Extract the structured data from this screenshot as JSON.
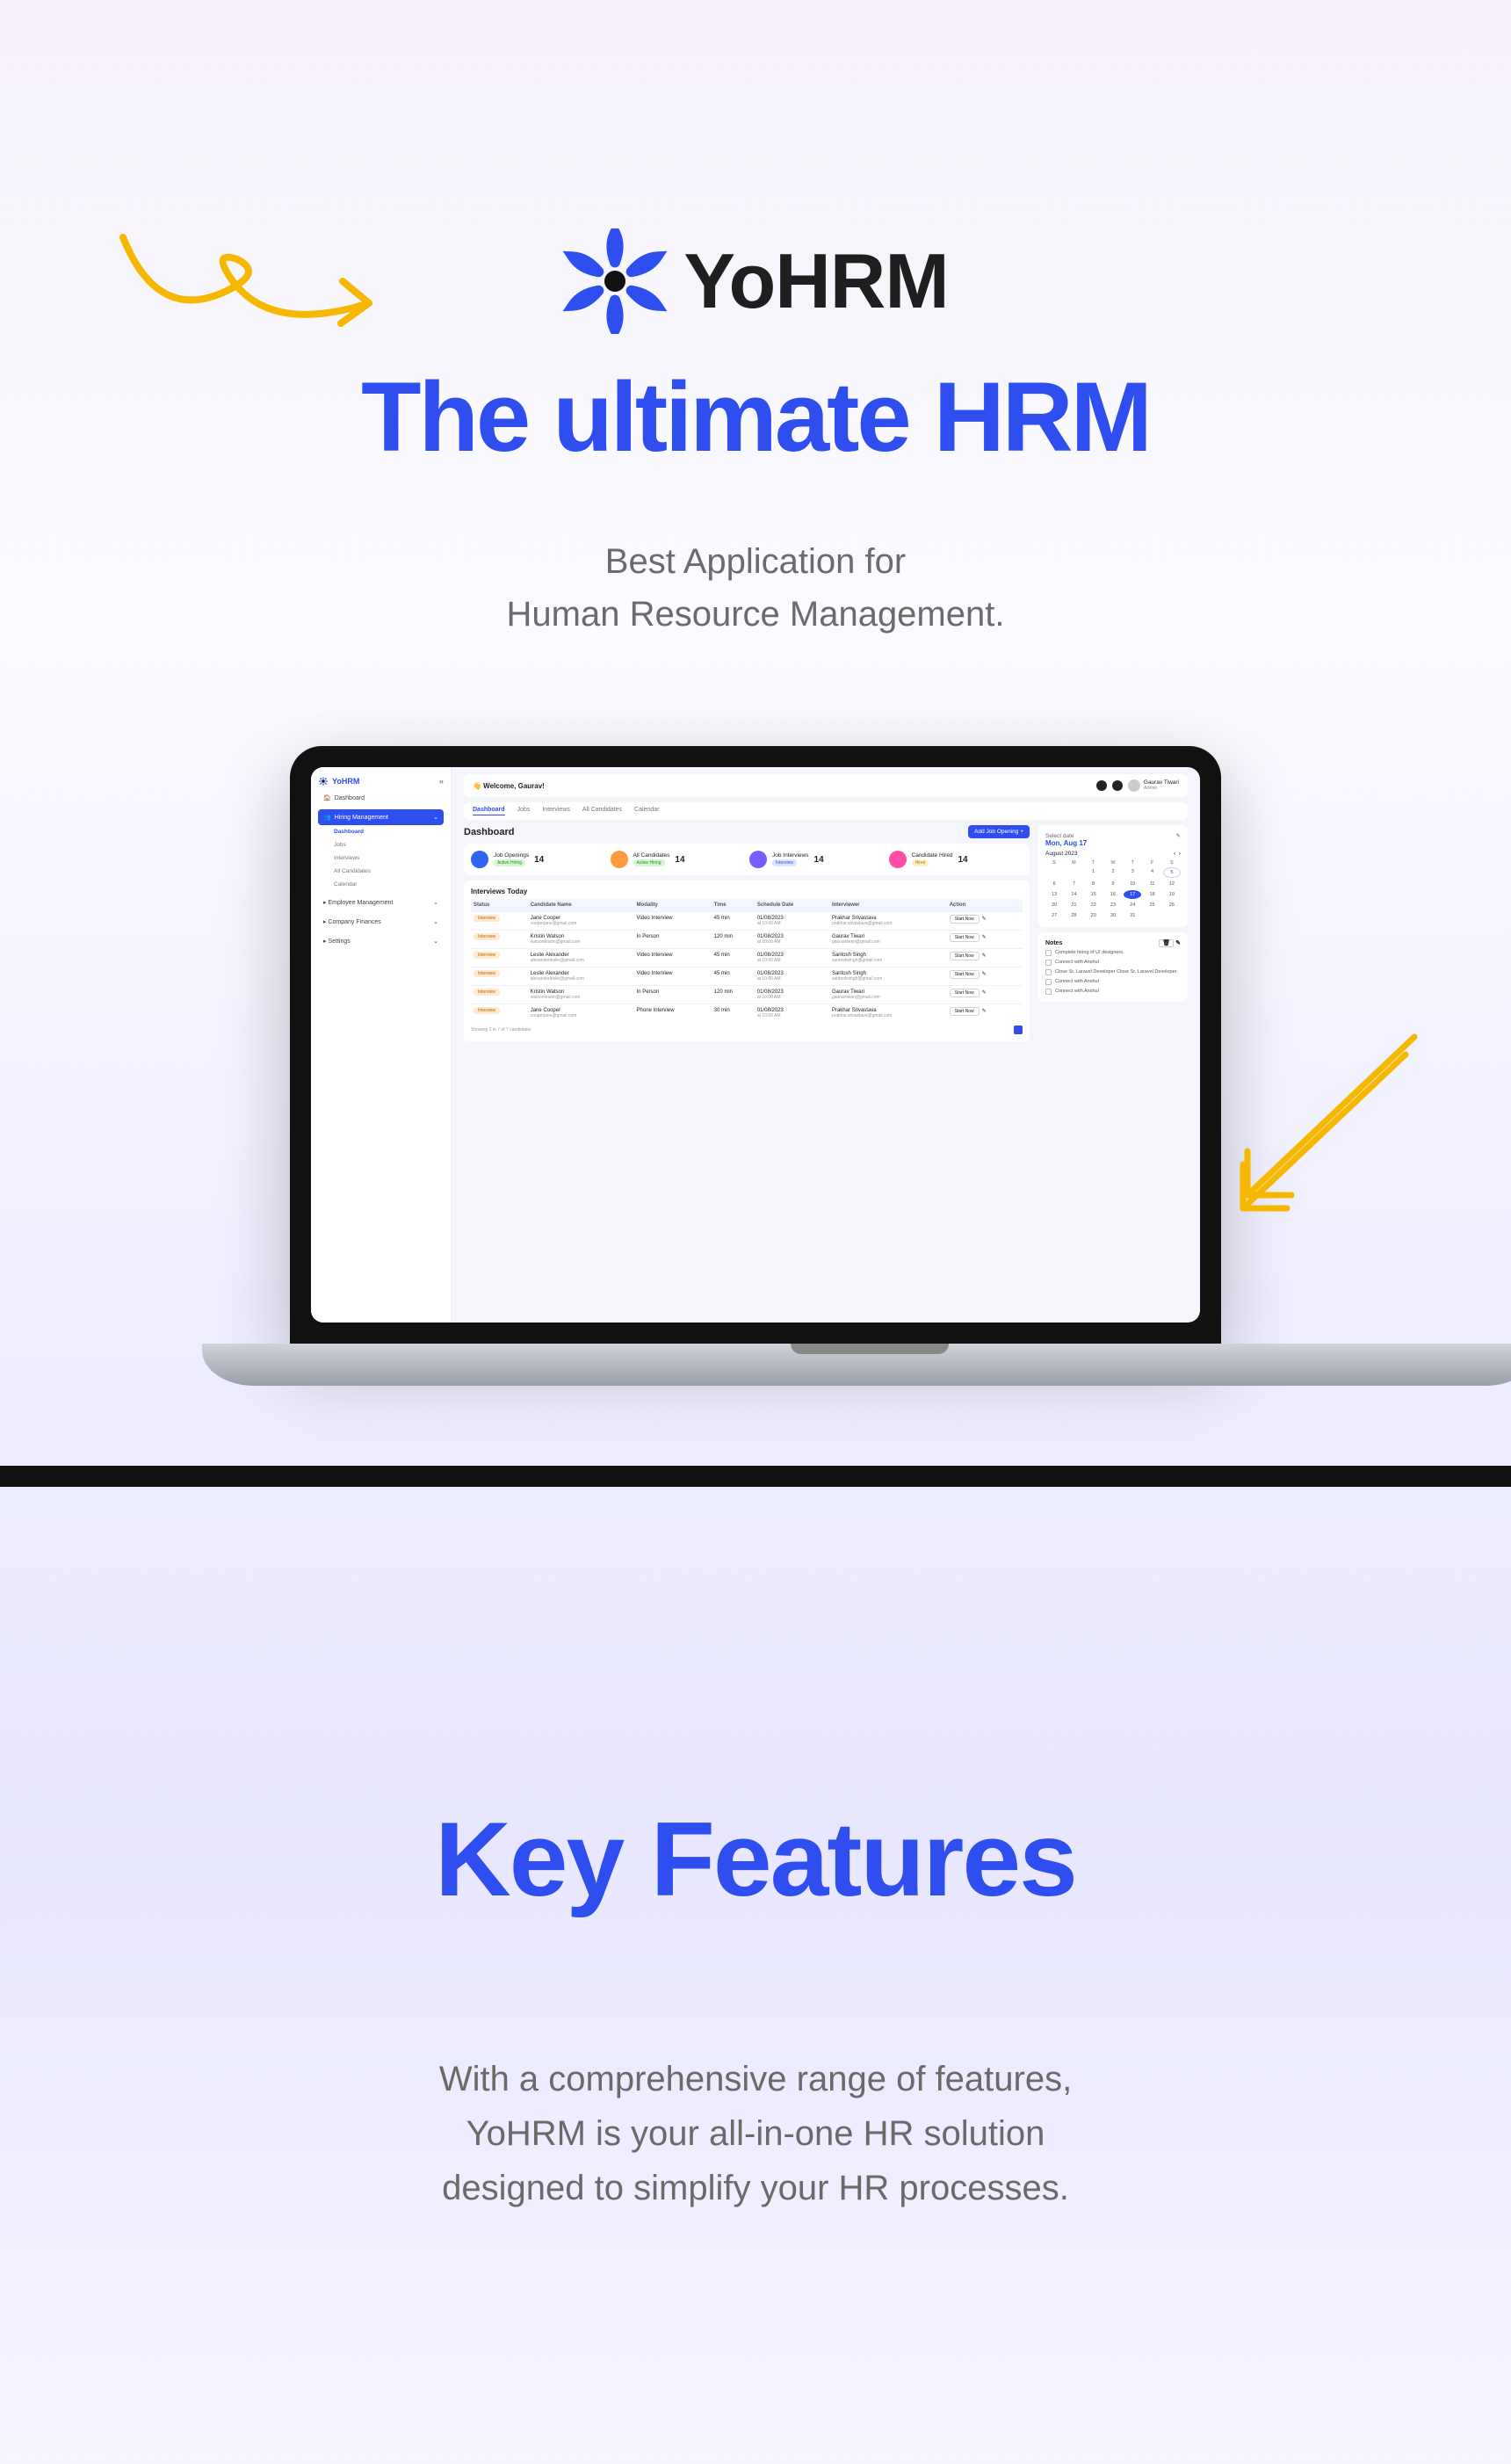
{
  "brand": {
    "name": "YoHRM"
  },
  "hero": {
    "headline": "The ultimate HRM",
    "sub1": "Best Application for",
    "sub2": "Human Resource Management."
  },
  "dashboard": {
    "sidebar_logo": "YoHRM",
    "sidebar": {
      "items": [
        {
          "icon": "home",
          "label": "Dashboard"
        },
        {
          "icon": "hiring",
          "label": "Hiring Management"
        }
      ],
      "subitems": [
        "Dashboard",
        "Jobs",
        "Interviews",
        "All Candidates",
        "Calendar"
      ],
      "items2": [
        {
          "icon": "emp",
          "label": "Employee Management"
        },
        {
          "icon": "fin",
          "label": "Company Finances"
        },
        {
          "icon": "set",
          "label": "Settings"
        }
      ]
    },
    "topbar": {
      "welcome_prefix": "👋 Welcome, ",
      "welcome_name": "Gaurav!",
      "user_name": "Gaurav Tiwari",
      "user_role": "Admin"
    },
    "tabs": [
      "Dashboard",
      "Jobs",
      "Interviews",
      "All Candidates",
      "Calendar"
    ],
    "title": "Dashboard",
    "add_button": "Add Job Opening  +",
    "stats": [
      {
        "label": "Job Openings",
        "value": "14",
        "pill": "Active Hiring",
        "pill_cls": "p-green",
        "color": "c-blue"
      },
      {
        "label": "All Candidates",
        "value": "14",
        "pill": "Active Hiring",
        "pill_cls": "p-green",
        "color": "c-orange"
      },
      {
        "label": "Job Interviews",
        "value": "14",
        "pill": "Interview",
        "pill_cls": "p-blue",
        "color": "c-purple"
      },
      {
        "label": "Candidate Hired",
        "value": "14",
        "pill": "Hired",
        "pill_cls": "p-yellow",
        "color": "c-pink"
      }
    ],
    "table_title": "Interviews Today",
    "columns": [
      "Status",
      "Candidate Name",
      "Modality",
      "Time",
      "Schedule Date",
      "Interviewer",
      "Action"
    ],
    "status_label": "Interview",
    "action_start": "Start Now",
    "rows": [
      {
        "name": "Jane Cooper",
        "email": "cooperjane@gmail.com",
        "modality": "Video Interview",
        "time": "45 min",
        "date": "01/08/2023",
        "date2": "at 10:00 AM",
        "interviewer": "Prakhar Srivastava",
        "interviewer_email": "prakhar.srivastava@gmail.com"
      },
      {
        "name": "Kristin Watson",
        "email": "watsonkristin@gmail.com",
        "modality": "In Person",
        "time": "120 min",
        "date": "01/08/2023",
        "date2": "at 10:00 AM",
        "interviewer": "Gaurav Tiwari",
        "interviewer_email": "gauravtiwari@gmail.com"
      },
      {
        "name": "Leslie Alexander",
        "email": "alexanderleslie@gmail.com",
        "modality": "Video Interview",
        "time": "45 min",
        "date": "01/08/2023",
        "date2": "at 10:00 AM",
        "interviewer": "Santosh Singh",
        "interviewer_email": "santoshsingh@gmail.com"
      },
      {
        "name": "Leslie Alexander",
        "email": "alexanderleslie@gmail.com",
        "modality": "Video Interview",
        "time": "45 min",
        "date": "01/08/2023",
        "date2": "at 10:00 AM",
        "interviewer": "Santosh Singh",
        "interviewer_email": "santoshsingh@gmail.com"
      },
      {
        "name": "Kristin Watson",
        "email": "watsonkristin@gmail.com",
        "modality": "In Person",
        "time": "120 min",
        "date": "01/08/2023",
        "date2": "at 10:00 AM",
        "interviewer": "Gaurav Tiwari",
        "interviewer_email": "gauravtiwari@gmail.com"
      },
      {
        "name": "Jane Cooper",
        "email": "cooperjane@gmail.com",
        "modality": "Phone Interview",
        "time": "30 min",
        "date": "01/08/2023",
        "date2": "at 10:00 AM",
        "interviewer": "Prakhar Srivastava",
        "interviewer_email": "prakhar.srivastava@gmail.com"
      }
    ],
    "paging_text": "Showing 1 to 7 of 7 candidates",
    "calendar": {
      "select_label": "Select date",
      "selected": "Mon, Aug 17",
      "month": "August 2023",
      "dow": [
        "S",
        "M",
        "T",
        "W",
        "T",
        "F",
        "S"
      ],
      "weeks": [
        [
          "",
          "1",
          "2",
          "3",
          "4",
          "5"
        ],
        [
          "6",
          "7",
          "8",
          "9",
          "10",
          "11",
          "12"
        ],
        [
          "13",
          "14",
          "15",
          "16",
          "17",
          "18",
          "19"
        ],
        [
          "20",
          "21",
          "22",
          "23",
          "24",
          "25",
          "26"
        ],
        [
          "27",
          "28",
          "29",
          "30",
          "31",
          "",
          ""
        ]
      ],
      "today": "17",
      "ring": "5"
    },
    "notes": {
      "title": "Notes",
      "items": [
        "Complete hiring of UI designers.",
        "Connect with Anshul",
        "Close Sr. Laravel Developer Close Sr. Laravel Developer",
        "Connect with Anshul",
        "Connect with Anshul"
      ]
    }
  },
  "features": {
    "title": "Key Features",
    "desc1": "With a comprehensive range of features,",
    "desc2": "YoHRM is your all-in-one HR solution",
    "desc3": "designed to simplify your HR processes."
  }
}
